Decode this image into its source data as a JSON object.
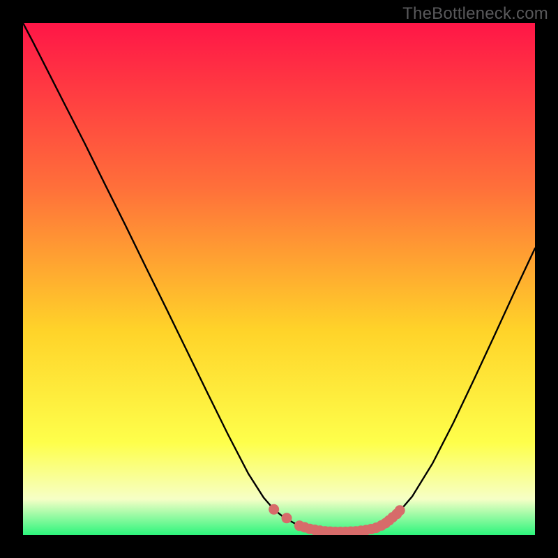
{
  "watermark": "TheBottleneck.com",
  "colors": {
    "grad_top": "#ff1647",
    "grad_upper": "#ff6f3a",
    "grad_mid": "#ffd329",
    "grad_lower": "#feff4b",
    "grad_pale": "#f6ffc6",
    "grad_green": "#2cf57c",
    "line": "#000000",
    "marker": "#d76b6a",
    "bg": "#000000"
  },
  "chart_data": {
    "type": "line",
    "title": "",
    "xlabel": "",
    "ylabel": "",
    "xlim": [
      0,
      100
    ],
    "ylim": [
      0,
      100
    ],
    "series": [
      {
        "name": "curve",
        "x": [
          0,
          2,
          5,
          8,
          12,
          16,
          20,
          24,
          28,
          32,
          36,
          40,
          44,
          47,
          49,
          51,
          53,
          55,
          57,
          59,
          61,
          63,
          65,
          67,
          69,
          71,
          73,
          76,
          80,
          84,
          88,
          92,
          96,
          100
        ],
        "y": [
          100,
          96.2,
          90.3,
          84.4,
          76.6,
          68.5,
          60.5,
          52.3,
          44.2,
          36,
          27.8,
          19.7,
          12,
          7.3,
          5,
          3.4,
          2.3,
          1.5,
          1,
          0.7,
          0.6,
          0.6,
          0.7,
          0.9,
          1.4,
          2.4,
          4,
          7.5,
          14,
          21.8,
          30.2,
          38.8,
          47.5,
          56
        ]
      }
    ],
    "markers": [
      {
        "x": 49,
        "y": 5
      },
      {
        "x": 51.5,
        "y": 3.3
      },
      {
        "x": 54,
        "y": 1.8
      },
      {
        "x": 55,
        "y": 1.5
      },
      {
        "x": 56,
        "y": 1.2
      },
      {
        "x": 57,
        "y": 1
      },
      {
        "x": 58,
        "y": 0.85
      },
      {
        "x": 59,
        "y": 0.72
      },
      {
        "x": 60,
        "y": 0.64
      },
      {
        "x": 61,
        "y": 0.6
      },
      {
        "x": 62,
        "y": 0.6
      },
      {
        "x": 63,
        "y": 0.62
      },
      {
        "x": 64,
        "y": 0.66
      },
      {
        "x": 65,
        "y": 0.72
      },
      {
        "x": 66,
        "y": 0.83
      },
      {
        "x": 67,
        "y": 0.95
      },
      {
        "x": 68,
        "y": 1.15
      },
      {
        "x": 69,
        "y": 1.42
      },
      {
        "x": 70,
        "y": 1.85
      },
      {
        "x": 70.8,
        "y": 2.3
      },
      {
        "x": 71.5,
        "y": 2.85
      },
      {
        "x": 72.2,
        "y": 3.45
      },
      {
        "x": 73,
        "y": 4.1
      },
      {
        "x": 73.6,
        "y": 4.8
      }
    ]
  }
}
